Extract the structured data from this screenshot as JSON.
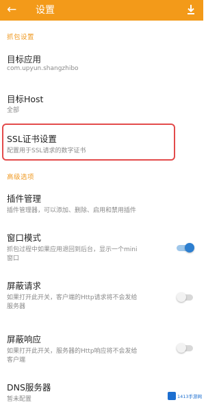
{
  "appbar": {
    "back_icon": "arrow-left-icon",
    "title": "设置",
    "download_icon": "download-icon",
    "color": "#f39a19"
  },
  "sections": [
    {
      "header": "抓包设置"
    },
    {
      "header": "高级选项"
    }
  ],
  "items": {
    "target_app": {
      "title": "目标应用",
      "subtitle": "com.upyun.shangzhibo"
    },
    "target_host": {
      "title": "目标Host",
      "subtitle": "全部"
    },
    "ssl": {
      "title": "SSL证书设置",
      "subtitle": "配置用于SSL请求的数字证书"
    },
    "plugins": {
      "title": "插件管理",
      "subtitle": "插件管理器，可以添加、删除、启用和禁用插件"
    },
    "window_mode": {
      "title": "窗口模式",
      "subtitle": "抓包过程中如果应用退回到后台，显示一个mini",
      "subtitle2": "窗口",
      "enabled": true
    },
    "block_request": {
      "title": "屏蔽请求",
      "subtitle": "如果打开此开关，客户端的Http请求将不会发给",
      "subtitle2": "服务器",
      "enabled": false
    },
    "block_response": {
      "title": "屏蔽响应",
      "subtitle": "如果打开此开关，服务器的Http响应将不会发给",
      "subtitle2": "客户端",
      "enabled": false
    },
    "dns": {
      "title": "DNS服务器",
      "subtitle": "暂未配置"
    }
  },
  "highlight_color": "#e34a4a",
  "watermark": {
    "text": "1413手游网"
  }
}
